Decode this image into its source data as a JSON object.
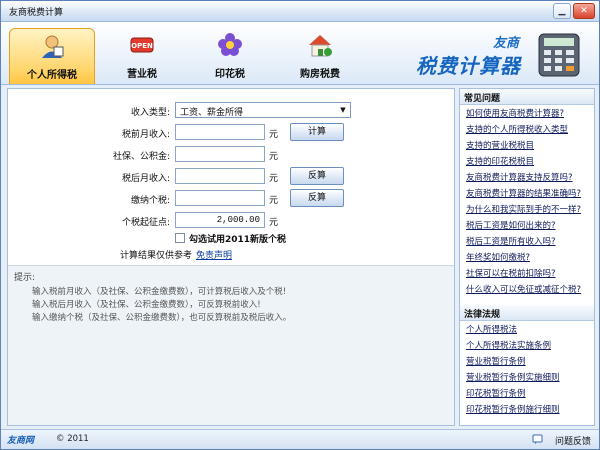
{
  "window": {
    "title": "友商税费计算"
  },
  "tabs": [
    {
      "label": "个人所得税",
      "icon": "person-tax-icon",
      "active": true
    },
    {
      "label": "营业税",
      "icon": "open-sign-icon",
      "active": false
    },
    {
      "label": "印花税",
      "icon": "flower-icon",
      "active": false
    },
    {
      "label": "购房税费",
      "icon": "house-icon",
      "active": false
    }
  ],
  "brand": {
    "small": "友商",
    "big": "税费计算器"
  },
  "form": {
    "income_type": {
      "label": "收入类型:",
      "value": "工资、薪金所得"
    },
    "pre_tax": {
      "label": "税前月收入:",
      "value": "",
      "unit": "元",
      "button": "计算"
    },
    "insurance": {
      "label": "社保、公积金:",
      "value": "",
      "unit": "元"
    },
    "after_tax": {
      "label": "税后月收入:",
      "value": "",
      "unit": "元",
      "button": "反算"
    },
    "tax_paid": {
      "label": "缴纳个税:",
      "value": "",
      "unit": "元",
      "button": "反算"
    },
    "threshold": {
      "label": "个税起征点:",
      "value": "2,000.00",
      "unit": "元"
    },
    "try_new": {
      "label": "勾选试用2011新版个税",
      "checked": false
    },
    "note": "计算结果仅供参考",
    "disclaimer": "免责声明"
  },
  "tips": {
    "title": "提示:",
    "lines": [
      "输入税前月收入（及社保、公积金缴费数），可计算税后收入及个税!",
      "输入税后月收入（及社保、公积金缴费数），可反算税前收入!",
      "输入缴纳个税（及社保、公积金缴费数），也可反算税前及税后收入。"
    ]
  },
  "faq": {
    "title": "常见问题",
    "items": [
      "如何使用友商税费计算器?",
      "支持的个人所得税收入类型",
      "支持的营业税税目",
      "支持的印花税税目",
      "友商税费计算器支持反算吗?",
      "友商税费计算器的结果准确吗?",
      "为什么和我实际到手的不一样?",
      "税后工资是如何出来的?",
      "税后工资是所有收入吗?",
      "年终奖如何缴税?",
      "社保可以在税前扣除吗?",
      "什么收入可以免征或减征个税?"
    ]
  },
  "laws": {
    "title": "法律法规",
    "items": [
      "个人所得税法",
      "个人所得税法实施条例",
      "营业税暂行条例",
      "营业税暂行条例实施细则",
      "印花税暂行条例",
      "印花税暂行条例施行细则"
    ]
  },
  "status": {
    "logo": "友商网",
    "copyright": "© 2011",
    "feedback": "问题反馈"
  },
  "colors": {
    "accent": "#1766c0",
    "active_tab": "#ffd772",
    "link": "#101b5c"
  }
}
